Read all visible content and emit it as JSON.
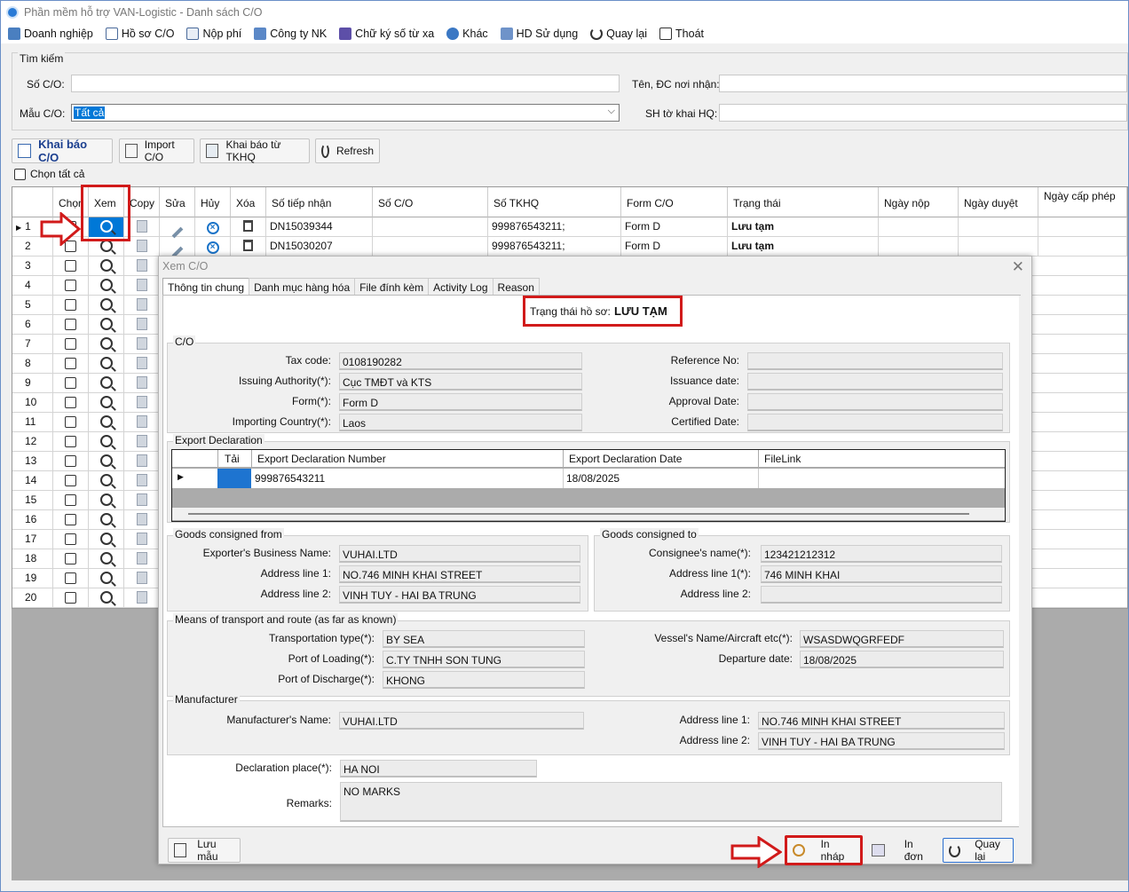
{
  "window": {
    "title": "Phần mềm hỗ trợ VAN-Logistic - Danh sách C/O"
  },
  "menu": [
    {
      "label": "Doanh nghiệp",
      "icon": "building-icon"
    },
    {
      "label": "Hồ sơ C/O",
      "icon": "document-icon"
    },
    {
      "label": "Nộp phí",
      "icon": "payment-icon"
    },
    {
      "label": "Công ty NK",
      "icon": "company-icon"
    },
    {
      "label": "Chữ ký số từ xa",
      "icon": "signature-icon"
    },
    {
      "label": "Khác",
      "icon": "gear-icon"
    },
    {
      "label": "HD Sử dụng",
      "icon": "help-icon"
    },
    {
      "label": "Quay lại",
      "icon": "refresh-icon"
    },
    {
      "label": "Thoát",
      "icon": "exit-icon"
    }
  ],
  "search": {
    "legend": "Tìm kiếm",
    "so_co_label": "Số C/O:",
    "so_co_value": "",
    "mau_co_label": "Mẫu C/O:",
    "mau_co_value": "Tất cả",
    "ten_dc_label": "Tên, ĐC nơi nhận:",
    "ten_dc_value": "",
    "sh_to_khai_label": "SH tờ khai HQ:",
    "sh_to_khai_value": ""
  },
  "toolbar": {
    "khai_bao": "Khai báo C/O",
    "import": "Import C/O",
    "khai_bao_tkhq": "Khai báo từ TKHQ",
    "refresh": "Refresh",
    "chon_tat_ca": "Chọn tất cả"
  },
  "grid": {
    "headers": [
      "Chọn",
      "Xem",
      "Copy",
      "Sửa",
      "Hủy",
      "Xóa",
      "Số tiếp nhận",
      "Số C/O",
      "Số TKHQ",
      "Form C/O",
      "Trạng thái",
      "Ngày nộp",
      "Ngày duyệt",
      "Ngày cấp phép"
    ],
    "rows": [
      {
        "n": "1",
        "so_tiep_nhan": "DN15039344",
        "so_co": "",
        "so_tkhq": "999876543211;",
        "form": "Form D",
        "trang_thai": "Lưu tạm"
      },
      {
        "n": "2",
        "so_tiep_nhan": "DN15030207",
        "so_co": "",
        "so_tkhq": "999876543211;",
        "form": "Form D",
        "trang_thai": "Lưu tạm"
      },
      {
        "n": "3"
      },
      {
        "n": "4"
      },
      {
        "n": "5"
      },
      {
        "n": "6"
      },
      {
        "n": "7"
      },
      {
        "n": "8"
      },
      {
        "n": "9"
      },
      {
        "n": "10"
      },
      {
        "n": "11"
      },
      {
        "n": "12"
      },
      {
        "n": "13"
      },
      {
        "n": "14"
      },
      {
        "n": "15"
      },
      {
        "n": "16"
      },
      {
        "n": "17"
      },
      {
        "n": "18"
      },
      {
        "n": "19"
      },
      {
        "n": "20"
      }
    ]
  },
  "dialog": {
    "title": "Xem C/O",
    "tabs": [
      "Thông tin chung",
      "Danh mục hàng hóa",
      "File đính kèm",
      "Activity Log",
      "Reason"
    ],
    "status_label": "Trạng thái hồ sơ:",
    "status_value": "LƯU TẠM",
    "co": {
      "legend": "C/O",
      "tax_code_label": "Tax code:",
      "tax_code": "0108190282",
      "issuing_label": "Issuing Authority(*):",
      "issuing": "Cục TMĐT và KTS",
      "form_label": "Form(*):",
      "form": "Form D",
      "importing_label": "Importing Country(*):",
      "importing": "Laos",
      "reference_label": "Reference No:",
      "reference": "",
      "issuance_label": "Issuance date:",
      "issuance": "",
      "approval_label": "Approval Date:",
      "approval": "",
      "certified_label": "Certified Date:",
      "certified": ""
    },
    "export": {
      "legend": "Export Declaration",
      "headers": [
        "Tải",
        "Export Declaration Number",
        "Export Declaration Date",
        "FileLink"
      ],
      "rows": [
        {
          "number": "999876543211",
          "date": "18/08/2025",
          "filelink": ""
        }
      ]
    },
    "from": {
      "legend": "Goods consigned from",
      "name_label": "Exporter's Business Name:",
      "name": "VUHAI.LTD",
      "addr1_label": "Address line 1:",
      "addr1": "NO.746 MINH KHAI STREET",
      "addr2_label": "Address line 2:",
      "addr2": "VINH TUY - HAI BA TRUNG"
    },
    "to": {
      "legend": "Goods consigned to",
      "name_label": "Consignee's name(*):",
      "name": "123421212312",
      "addr1_label": "Address line 1(*):",
      "addr1": "746 MINH KHAI",
      "addr2_label": "Address line 2:",
      "addr2": ""
    },
    "transport": {
      "legend": "Means of transport and route (as far as known)",
      "type_label": "Transportation type(*):",
      "type": "BY SEA",
      "loading_label": "Port of Loading(*):",
      "loading": "C.TY TNHH SON TUNG",
      "discharge_label": "Port of Discharge(*):",
      "discharge": "KHONG",
      "vessel_label": "Vessel's Name/Aircraft etc(*):",
      "vessel": "WSASDWQGRFEDF",
      "departure_label": "Departure date:",
      "departure": "18/08/2025"
    },
    "manufacturer": {
      "legend": "Manufacturer",
      "name_label": "Manufacturer's Name:",
      "name": "VUHAI.LTD",
      "addr1_label": "Address line 1:",
      "addr1": "NO.746 MINH KHAI STREET",
      "addr2_label": "Address line 2:",
      "addr2": "VINH TUY - HAI BA TRUNG"
    },
    "declaration_place_label": "Declaration place(*):",
    "declaration_place": "HA NOI",
    "remarks_label": "Remarks:",
    "remarks": "NO MARKS",
    "buttons": {
      "luu_mau": "Lưu mẫu",
      "in_nhap": "In nháp",
      "in_don": "In đơn",
      "quay_lai": "Quay lại"
    }
  },
  "colors": {
    "highlight": "#d11a1a",
    "selection": "#0078d7",
    "grid_empty": "#ababab"
  }
}
